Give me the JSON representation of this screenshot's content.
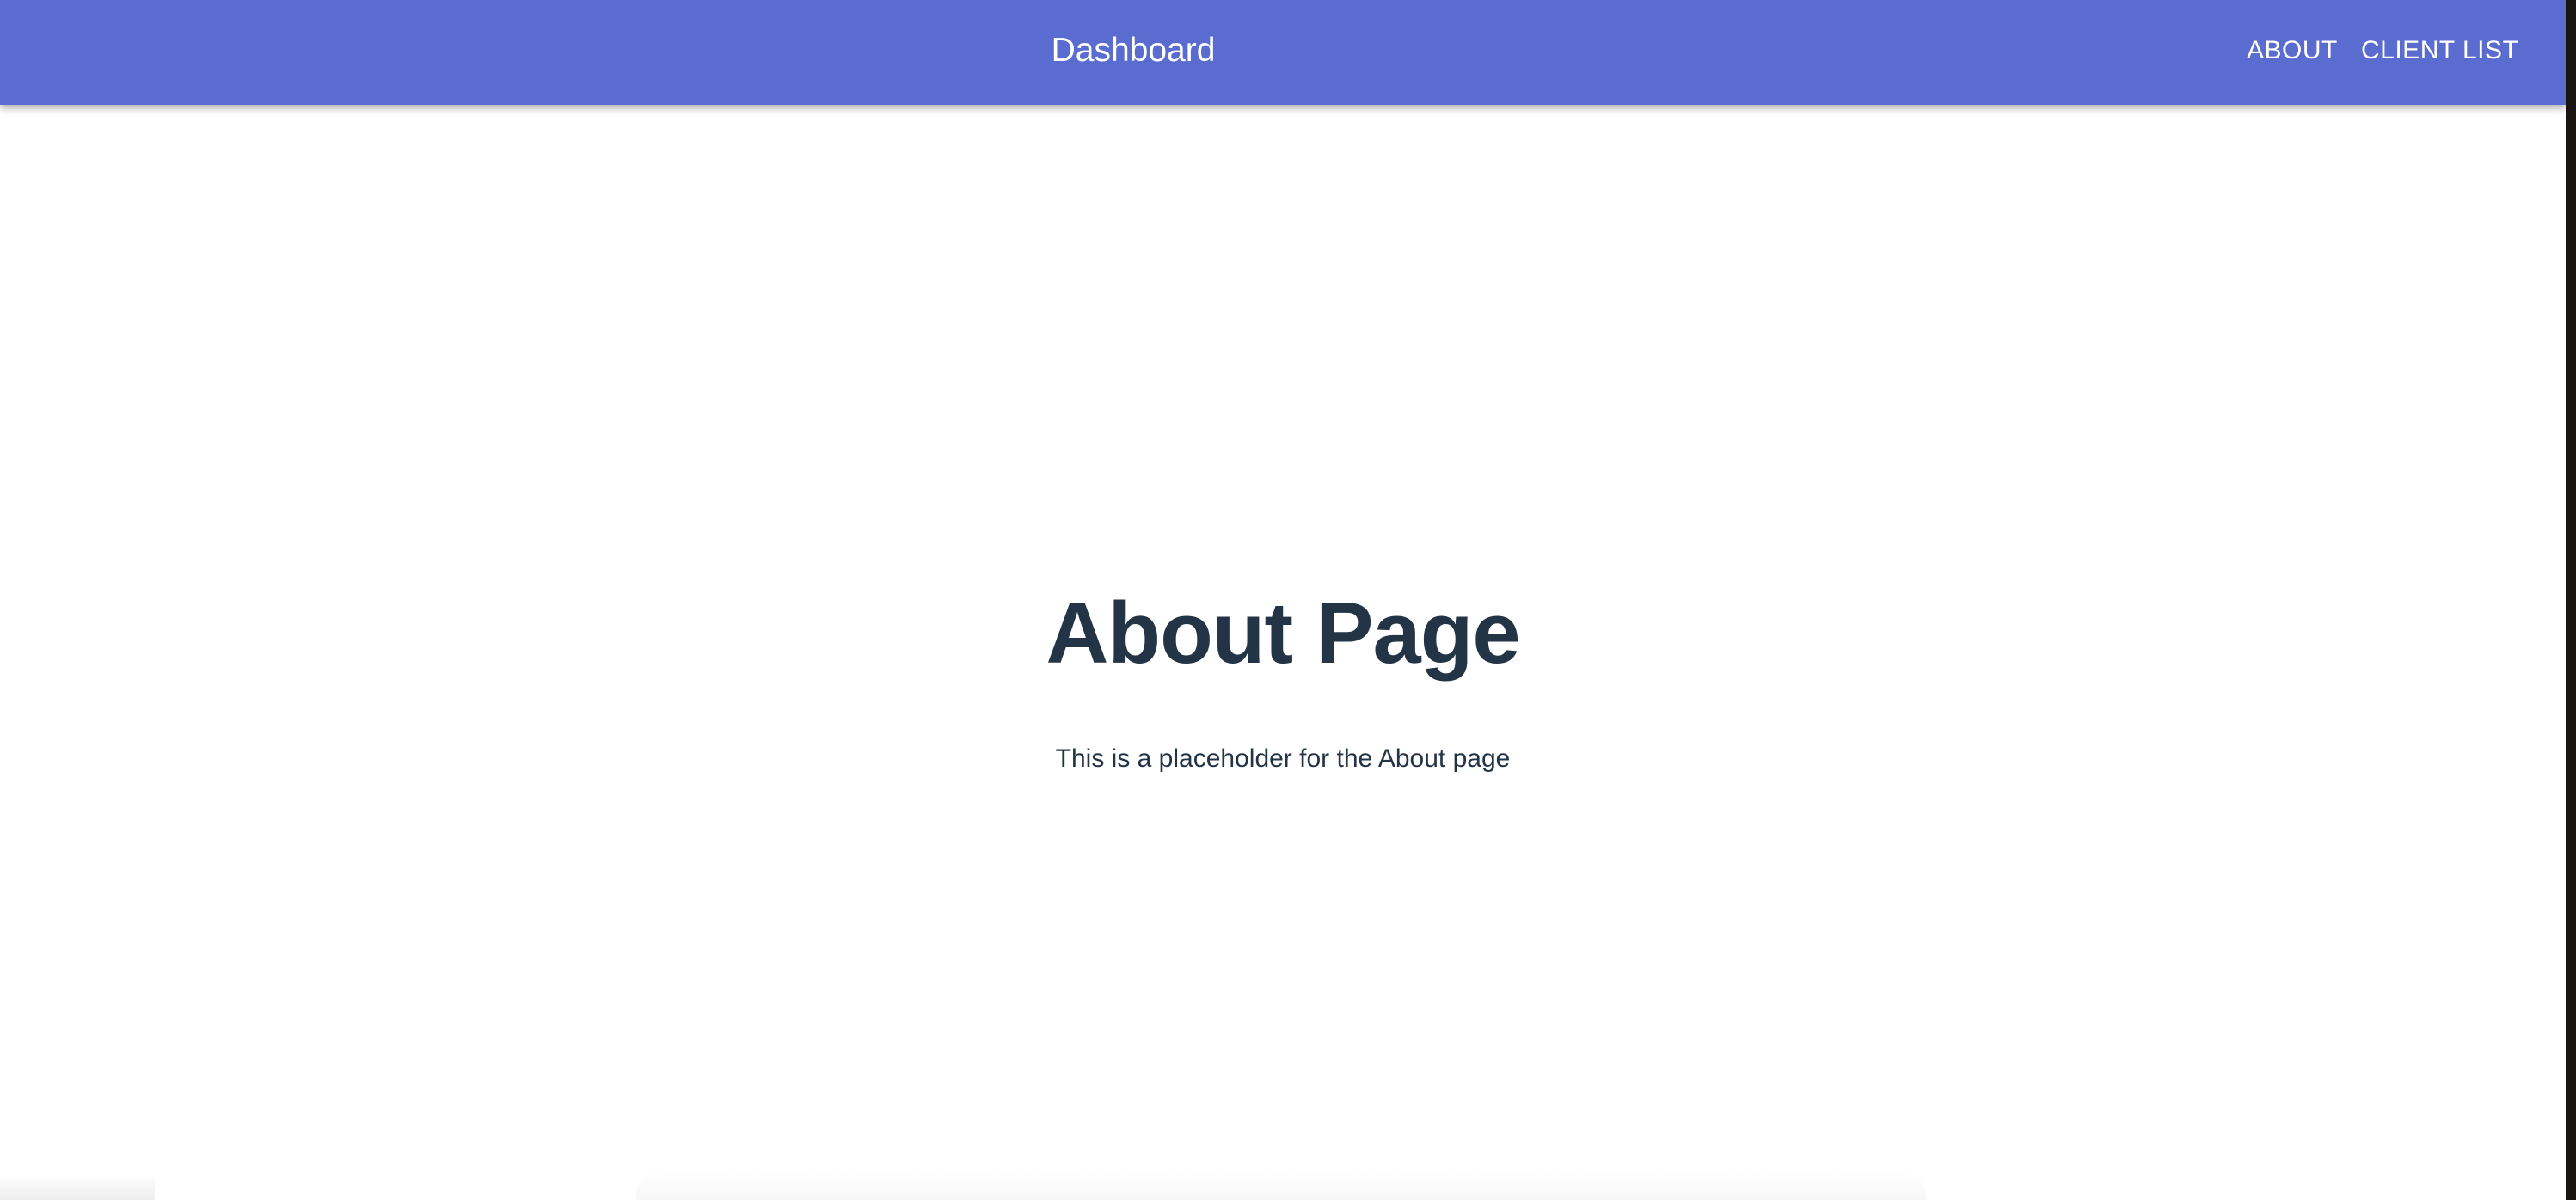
{
  "header": {
    "title": "Dashboard",
    "nav": [
      {
        "label": "ABOUT"
      },
      {
        "label": "CLIENT LIST"
      }
    ]
  },
  "main": {
    "heading": "About Page",
    "description": "This is a placeholder for the About page"
  },
  "colors": {
    "appbar": "#5a6ccf",
    "text": "#243447"
  }
}
